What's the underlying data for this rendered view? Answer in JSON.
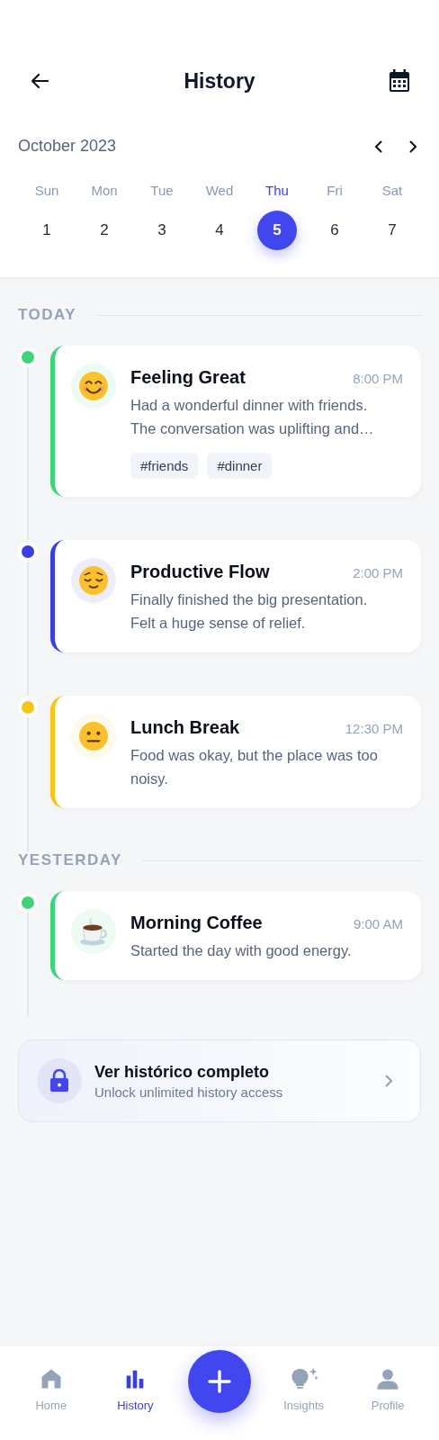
{
  "header": {
    "title": "History"
  },
  "calendar": {
    "month": "October 2023",
    "days": [
      {
        "weekday": "Sun",
        "day": "1",
        "selected": false
      },
      {
        "weekday": "Mon",
        "day": "2",
        "selected": false
      },
      {
        "weekday": "Tue",
        "day": "3",
        "selected": false
      },
      {
        "weekday": "Wed",
        "day": "4",
        "selected": false
      },
      {
        "weekday": "Thu",
        "day": "5",
        "selected": true
      },
      {
        "weekday": "Fri",
        "day": "6",
        "selected": false
      },
      {
        "weekday": "Sat",
        "day": "7",
        "selected": false
      }
    ]
  },
  "sections": [
    {
      "label": "TODAY",
      "entries": [
        {
          "kind": "smile",
          "color": "#3dd47a",
          "title": "Feeling Great",
          "time": "8:00 PM",
          "text": "Had a wonderful dinner with friends. The conversation was uplifting and…",
          "tags": [
            "#friends",
            "#dinner"
          ]
        },
        {
          "kind": "relieved",
          "color": "#3b3fe0",
          "title": "Productive Flow",
          "time": "2:00 PM",
          "text": "Finally finished the big presentation. Felt a huge sense of relief."
        },
        {
          "kind": "neutral",
          "color": "#f5c518",
          "title": "Lunch Break",
          "time": "12:30 PM",
          "text": "Food was okay, but the place was too noisy."
        }
      ]
    },
    {
      "label": "YESTERDAY",
      "entries": [
        {
          "kind": "coffee",
          "color": "#3dd47a",
          "title": "Morning Coffee",
          "time": "9:00 AM",
          "text": "Started the day with good energy."
        }
      ]
    }
  ],
  "promo": {
    "title": "Ver histórico completo",
    "subtitle": "Unlock unlimited history access"
  },
  "nav": [
    {
      "kind": "home",
      "label": "Home",
      "selected": false
    },
    {
      "kind": "history",
      "label": "History",
      "selected": true
    },
    {
      "kind": "add"
    },
    {
      "kind": "insights",
      "label": "Insights",
      "selected": false
    },
    {
      "kind": "profile",
      "label": "Profile",
      "selected": false
    }
  ]
}
